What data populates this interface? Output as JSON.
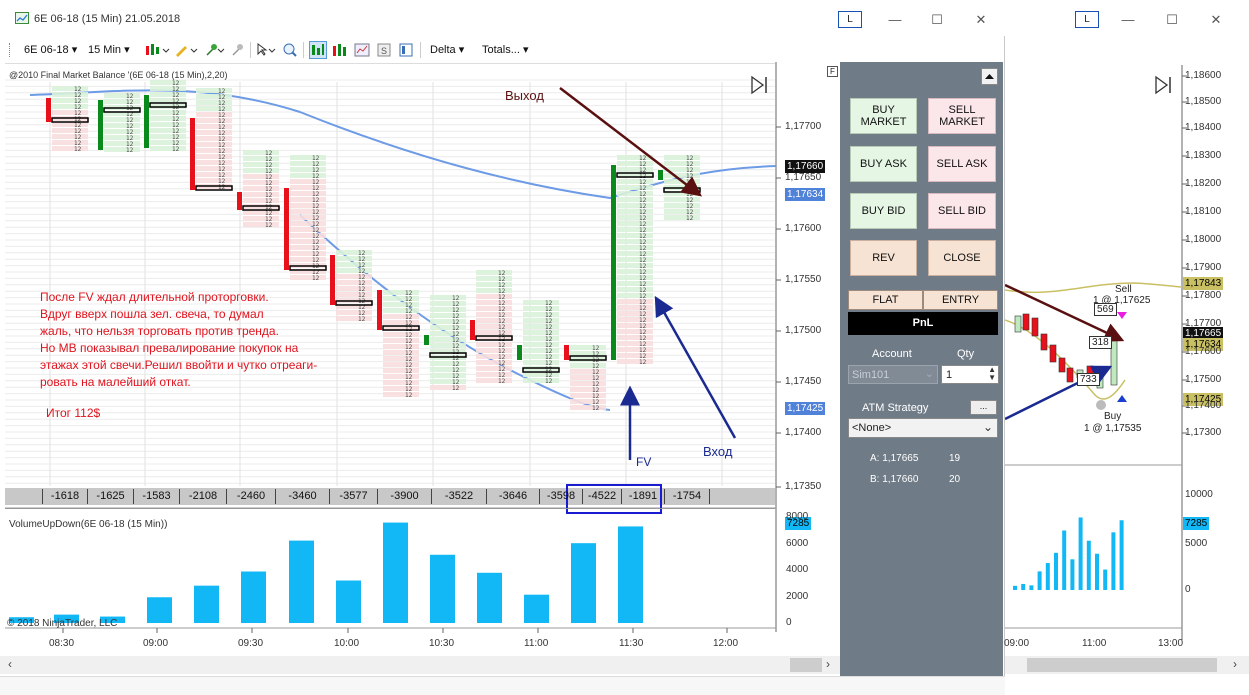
{
  "window": {
    "title": "6E 06-18 (15 Min)  21.05.2018",
    "l_label": "L",
    "minimize": "—",
    "maximize": "☐",
    "close": "✕"
  },
  "toolbar": {
    "instrument": "6E 06-18",
    "interval": "15 Min",
    "delta": "Delta",
    "totals": "Totals..."
  },
  "chart_main": {
    "indicator_label": "@2010 Final Market Balance  '(6E 06-18 (15 Min),2,20)",
    "price_ticks": [
      "1,17700",
      "1,17650",
      "1,17600",
      "1,17550",
      "1,17500",
      "1,17450",
      "1,17400",
      "1,17350"
    ],
    "last_price_badge": "1,17660",
    "blue_price_badge": "1,17634",
    "low_price_badge": "1,17425",
    "f_label": "F",
    "delta_values": [
      "-1618",
      "-1625",
      "-1583",
      "-2108",
      "-2460",
      "-3460",
      "-3577",
      "-3900",
      "-3522",
      "-3646",
      "-3598",
      "-4522",
      "-1891",
      "-1754"
    ],
    "volume_label": "VolumeUpDown(6E 06-18 (15 Min))",
    "volume_ticks": [
      "8000",
      "6000",
      "4000",
      "2000",
      "0"
    ],
    "volume_badge": "7285",
    "copyright": "© 2018 NinjaTrader, LLC",
    "time_ticks": [
      "08:30",
      "09:00",
      "09:30",
      "10:00",
      "10:30",
      "11:00",
      "11:30",
      "12:00"
    ],
    "annotation_exit": "Выход",
    "annotation_entry": "Вход",
    "annotation_fv": "FV",
    "note_lines": [
      "После FV ждал длительной проторговки.",
      "Вдруг вверх пошла зел. свеча, то думал",
      " жаль, что нельзя торговать против тренда.",
      "Но МВ показывал превалирование покупок на",
      "этажах этой свечи.Решил ввойти и чутко отреаги-",
      "ровать на малейший откат."
    ],
    "note_result": "Итог 112$",
    "volume_values": [
      450,
      650,
      500,
      2000,
      2900,
      4000,
      6400,
      3300,
      7800,
      5300,
      3900,
      2200,
      6200,
      7500
    ]
  },
  "trade_panel": {
    "buy_market": "BUY MARKET",
    "sell_market": "SELL MARKET",
    "buy_ask": "BUY ASK",
    "sell_ask": "SELL ASK",
    "buy_bid": "BUY BID",
    "sell_bid": "SELL BID",
    "rev": "REV",
    "close": "CLOSE",
    "flat": "FLAT",
    "entry": "ENTRY",
    "pnl": "PnL",
    "account_label": "Account",
    "qty_label": "Qty",
    "account_value": "Sim101",
    "qty_value": "1",
    "atm_label": "ATM Strategy",
    "atm_value": "<None>",
    "ask_line": "A: 1,17665",
    "ask_size": "19",
    "bid_line": "B: 1,17660",
    "bid_size": "20"
  },
  "chart_right": {
    "price_ticks": [
      "1,18600",
      "1,18500",
      "1,18400",
      "1,18300",
      "1,18200",
      "1,18100",
      "1,18000",
      "1,17900",
      "1,17800",
      "1,17700",
      "1,17600",
      "1,17500",
      "1,17400",
      "1,17300"
    ],
    "badge_843": "1,17843",
    "badge_665": "1,17665",
    "badge_634": "1,17634",
    "badge_425": "1,17425",
    "sell_label": "Sell",
    "sell_fill": "1 @ 1,17625",
    "buy_label": "Buy",
    "buy_fill": "1 @ 1,17535",
    "box_569": "569",
    "box_318": "318",
    "box_733": "733",
    "volume_ticks": [
      "10000",
      "5000",
      "0"
    ],
    "volume_badge": "7285",
    "time_ticks": [
      "09:00",
      "11:00",
      "13:00"
    ]
  },
  "colors": {
    "up": "#0a8a1a",
    "down": "#e8101a",
    "volume": "#12b8f5",
    "ma": "#6d9be6",
    "arrow_exit": "#5a1010",
    "arrow_entry": "#1b2a90"
  }
}
